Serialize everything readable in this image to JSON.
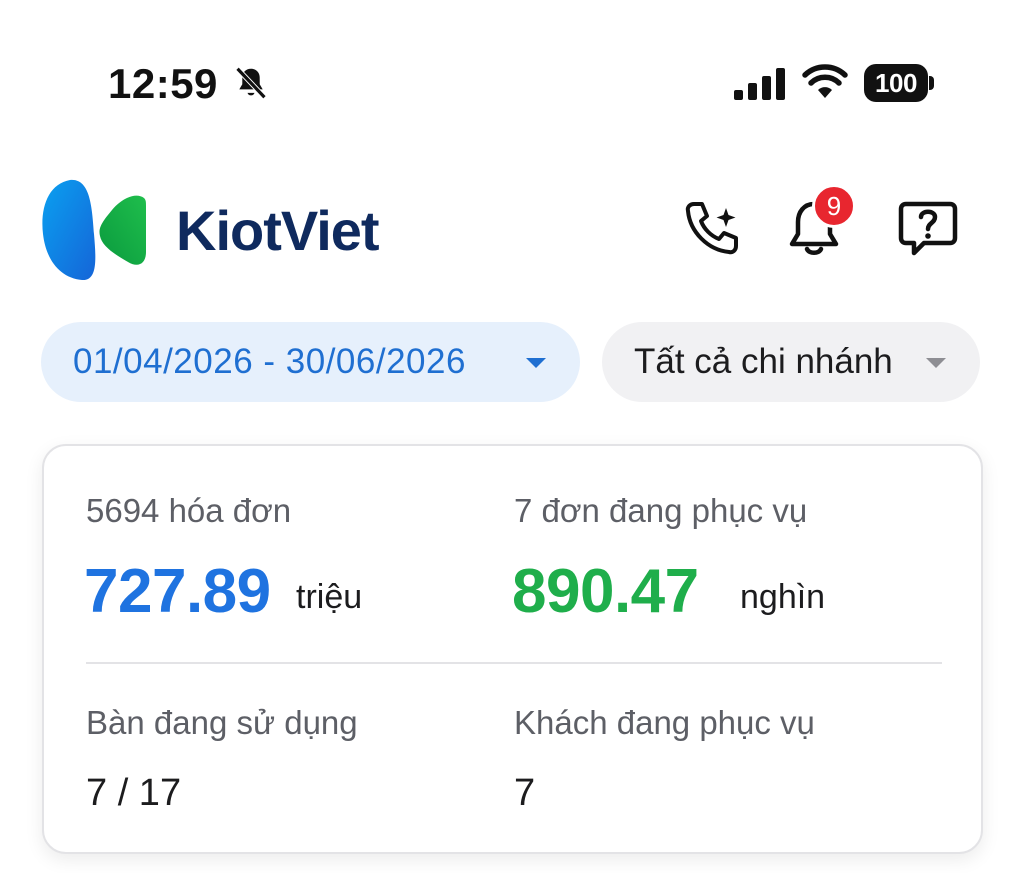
{
  "status_bar": {
    "time": "12:59",
    "battery": "100",
    "icons": [
      "bell-slash-icon",
      "signal-icon",
      "wifi-icon",
      "battery-icon"
    ]
  },
  "header": {
    "brand": "KiotViet",
    "notification_count": "9",
    "icons": [
      "phone-ai-icon",
      "bell-icon",
      "help-chat-icon"
    ],
    "colors": {
      "brand_text": "#0f2a5e",
      "logo_blue": "#1e88e5",
      "logo_green": "#22b14c",
      "badge": "#e8262f"
    }
  },
  "filters": {
    "date_range": "01/04/2026 - 30/06/2026",
    "branch": "Tất cả chi nhánh"
  },
  "summary": {
    "invoices_label": "5694 hóa đơn",
    "revenue_value": "727.89",
    "revenue_unit": "triệu",
    "serving_orders_label": "7 đơn đang phục vụ",
    "serving_value": "890.47",
    "serving_unit": "nghìn",
    "tables_label": "Bàn đang sử dụng",
    "tables_value": "7 / 17",
    "guests_label": "Khách đang phục vụ",
    "guests_value": "7",
    "colors": {
      "revenue": "#1f73e0",
      "serving": "#1fae4b"
    }
  }
}
